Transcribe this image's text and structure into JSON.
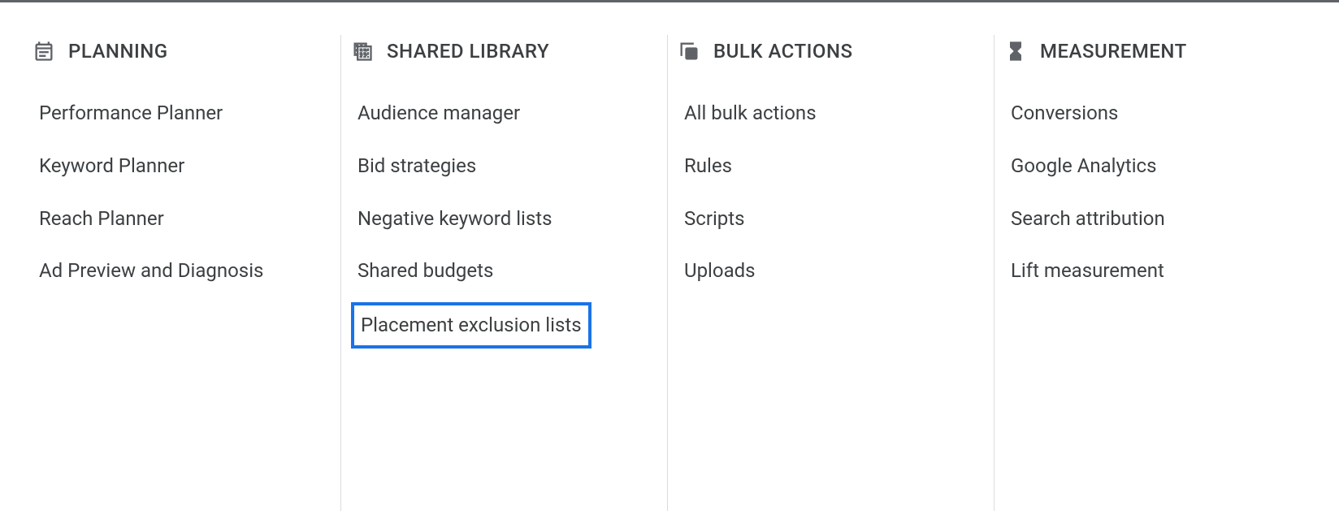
{
  "columns": [
    {
      "title": "PLANNING",
      "icon": "calendar-icon",
      "items": [
        {
          "label": "Performance Planner",
          "highlighted": false
        },
        {
          "label": "Keyword Planner",
          "highlighted": false
        },
        {
          "label": "Reach Planner",
          "highlighted": false
        },
        {
          "label": "Ad Preview and Diagnosis",
          "highlighted": false
        }
      ]
    },
    {
      "title": "SHARED LIBRARY",
      "icon": "grid-icon",
      "items": [
        {
          "label": "Audience manager",
          "highlighted": false
        },
        {
          "label": "Bid strategies",
          "highlighted": false
        },
        {
          "label": "Negative keyword lists",
          "highlighted": false
        },
        {
          "label": "Shared budgets",
          "highlighted": false
        },
        {
          "label": "Placement exclusion lists",
          "highlighted": true
        }
      ]
    },
    {
      "title": "BULK ACTIONS",
      "icon": "copy-icon",
      "items": [
        {
          "label": "All bulk actions",
          "highlighted": false
        },
        {
          "label": "Rules",
          "highlighted": false
        },
        {
          "label": "Scripts",
          "highlighted": false
        },
        {
          "label": "Uploads",
          "highlighted": false
        }
      ]
    },
    {
      "title": "MEASUREMENT",
      "icon": "hourglass-icon",
      "items": [
        {
          "label": "Conversions",
          "highlighted": false
        },
        {
          "label": "Google Analytics",
          "highlighted": false
        },
        {
          "label": "Search attribution",
          "highlighted": false
        },
        {
          "label": "Lift measurement",
          "highlighted": false
        }
      ]
    }
  ]
}
